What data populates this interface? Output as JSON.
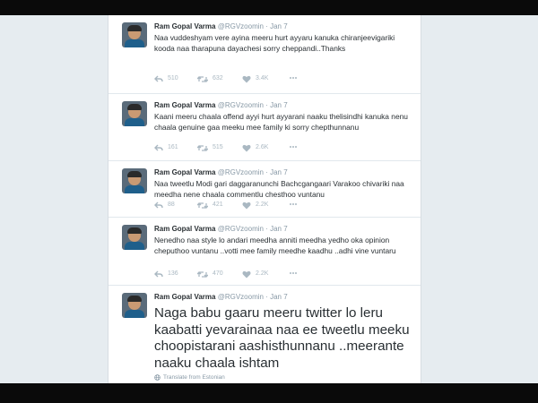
{
  "user": {
    "name": "Ram Gopal Varma",
    "handle": "@RGVzoomin",
    "separator": "·"
  },
  "tweets": [
    {
      "date": "Jan 7",
      "text": "Naa vuddeshyam vere ayina meeru hurt  ayyaru kanuka chiranjeevigariki kooda naa tharapuna dayachesi sorry cheppandi..Thanks",
      "replies": "510",
      "retweets": "632",
      "likes": "3.4K"
    },
    {
      "date": "Jan 7",
      "text": "Kaani meeru chaala offend ayyi hurt ayyarani naaku thelisindhi kanuka nenu chaala genuine gaa meeku mee family ki sorry chepthunnanu",
      "replies": "161",
      "retweets": "515",
      "likes": "2.6K"
    },
    {
      "date": "Jan 7",
      "text": "Naa tweetlu Modi gari daggaranunchi Bachcgangaari Varakoo chivariki naa meedha nene chaala commentlu chesthoo vuntanu",
      "replies": "88",
      "retweets": "421",
      "likes": "2.2K"
    },
    {
      "date": "Jan 7",
      "text": "Nenedho naa style lo andari meedha anniti meedha yedho oka opinion cheputhoo vuntanu ..votti mee family meedhe kaadhu ..adhi vine vuntaru",
      "replies": "136",
      "retweets": "470",
      "likes": "2.2K"
    },
    {
      "date": "Jan 7",
      "text": "Naga babu gaaru meeru twitter lo leru kaabatti yevarainaa naa ee tweetlu meeku choopistarani aashisthunnanu ..meerante naaku chaala ishtam",
      "translate": "Translate from Estonian"
    }
  ],
  "icons": {
    "reply": "reply-icon",
    "retweet": "retweet-icon",
    "like": "heart-icon",
    "more": "more-icon",
    "translate": "globe-icon"
  },
  "colors": {
    "background": "#e6ecf0",
    "card": "#ffffff",
    "text": "#292f33",
    "muted": "#8899a6",
    "icon": "#aab8c2",
    "letterbox": "#0a0a0a"
  }
}
